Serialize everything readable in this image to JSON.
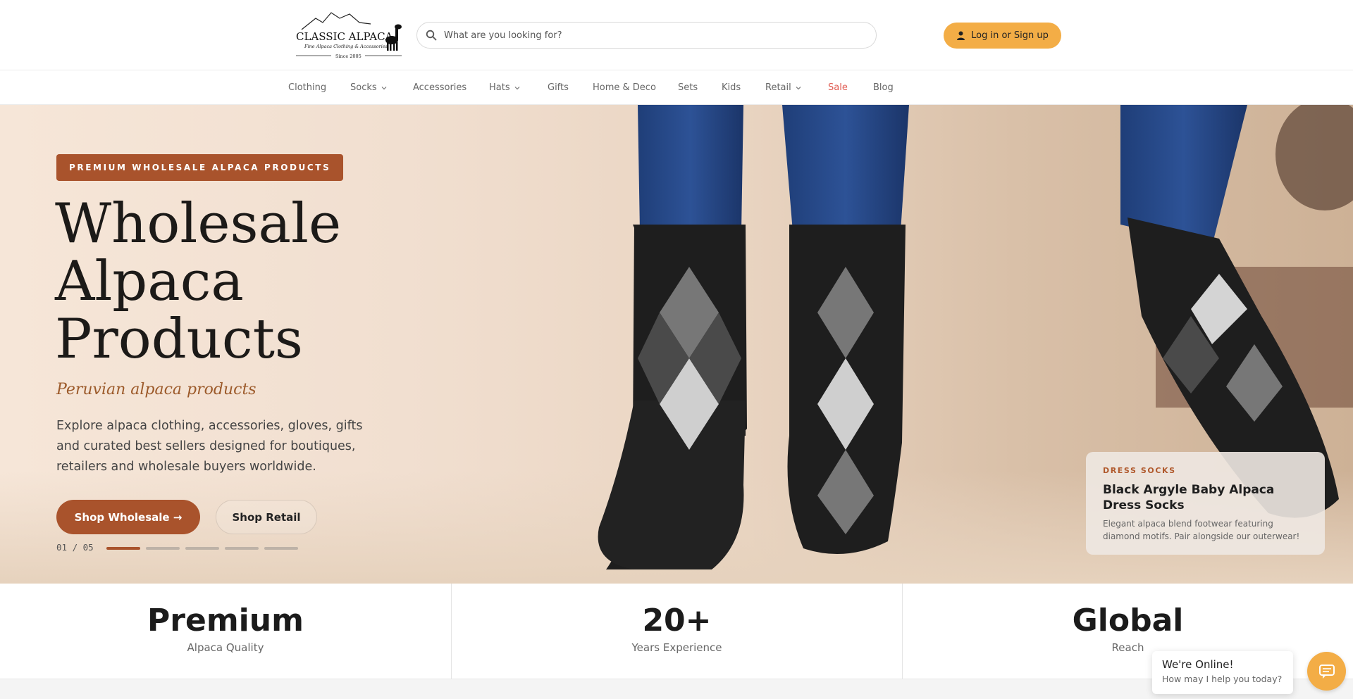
{
  "header": {
    "logo": {
      "brand": "CLASSIC ALPACA",
      "tagline": "Fine Alpaca Clothing & Accessories",
      "since": "Since 2005"
    },
    "search": {
      "placeholder": "What are you looking for?",
      "icon": "search-icon"
    },
    "login_label": "Log in or Sign up"
  },
  "nav": {
    "items": [
      {
        "label": "Clothing",
        "dropdown": false
      },
      {
        "label": "Socks",
        "dropdown": true
      },
      {
        "label": "Accessories",
        "dropdown": false
      },
      {
        "label": "Hats",
        "dropdown": true
      },
      {
        "label": "Gifts",
        "dropdown": false
      },
      {
        "label": "Home & Deco",
        "dropdown": false
      },
      {
        "label": "Sets",
        "dropdown": false
      },
      {
        "label": "Kids",
        "dropdown": false
      },
      {
        "label": "Retail",
        "dropdown": true
      },
      {
        "label": "Sale",
        "dropdown": false
      },
      {
        "label": "Blog",
        "dropdown": false
      }
    ],
    "sale_color": "#e05a50"
  },
  "hero": {
    "badge": "PREMIUM WHOLESALE ALPACA PRODUCTS",
    "title_lines": [
      "Wholesale",
      "Alpaca",
      "Products"
    ],
    "subtitle": "Peruvian alpaca products",
    "description": "Explore alpaca clothing, accessories, gloves, gifts and curated best sellers designed for boutiques, retailers and wholesale buyers worldwide.",
    "primary_button": "Shop Wholesale →",
    "secondary_button": "Shop Retail",
    "slide_counter": "01 / 05",
    "slide_count": 5,
    "active_slide": 1,
    "accent_color": "#a9532c"
  },
  "product_card": {
    "category": "DRESS SOCKS",
    "name": "Black Argyle Baby Alpaca Dress Socks",
    "description": "Elegant alpaca blend footwear featuring diamond motifs. Pair alongside our outerwear!"
  },
  "stats": [
    {
      "value": "Premium",
      "label": "Alpaca Quality"
    },
    {
      "value": "20+",
      "label": "Years Experience"
    },
    {
      "value": "Global",
      "label": "Reach"
    }
  ],
  "chat": {
    "title": "We're Online!",
    "subtitle": "How may I help you today?",
    "icon": "chat-icon",
    "color": "#f3ad46"
  }
}
